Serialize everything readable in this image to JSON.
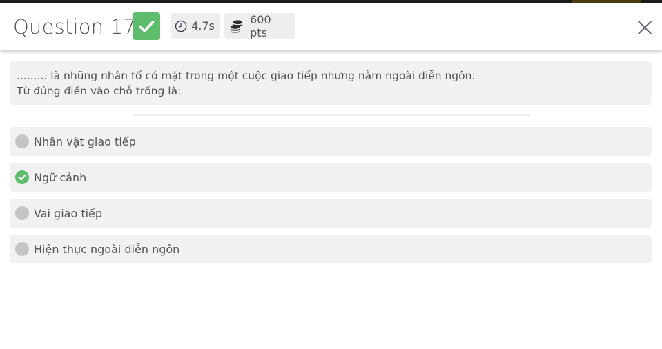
{
  "header": {
    "title": "Question 17",
    "status": "correct",
    "time": "4.7s",
    "points": "600 pts"
  },
  "question": {
    "line1": "......... là những nhân tố có mặt trong một cuộc giao tiếp nhưng nằm ngoài diễn ngôn.",
    "line2": "Từ đúng điền vào chỗ trống là:"
  },
  "options": [
    {
      "label": "Nhân vật giao tiếp",
      "correct": false
    },
    {
      "label": "Ngữ cảnh",
      "correct": true
    },
    {
      "label": "Vai giao tiếp",
      "correct": false
    },
    {
      "label": "Hiện thực ngoài diễn ngôn",
      "correct": false
    }
  ],
  "icons": {
    "status": "check-icon",
    "time": "clock-icon",
    "points": "coins-icon",
    "close": "close-icon"
  },
  "colors": {
    "correct_green": "#5dbd6d",
    "neutral_radio": "#c4c4c4",
    "panel_bg": "#f1f1f1"
  }
}
